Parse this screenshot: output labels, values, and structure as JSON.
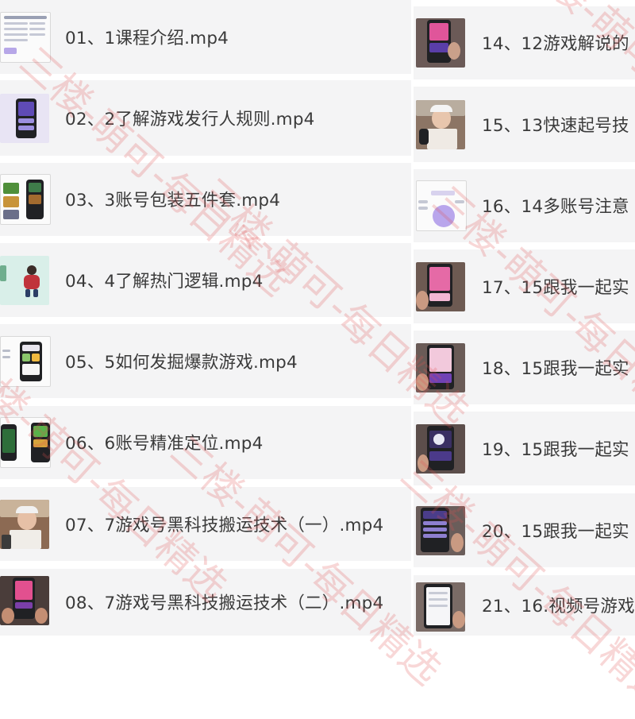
{
  "left_items": [
    {
      "label": "01、1课程介绍.mp4",
      "thumb": "slide-list"
    },
    {
      "label": "02、2了解游戏发行人规则.mp4",
      "thumb": "phone-app"
    },
    {
      "label": "03、3账号包装五件套.mp4",
      "thumb": "game-covers"
    },
    {
      "label": "04、4了解热门逻辑.mp4",
      "thumb": "illustration"
    },
    {
      "label": "05、5如何发掘爆款游戏.mp4",
      "thumb": "phone-app"
    },
    {
      "label": "06、6账号精准定位.mp4",
      "thumb": "phones-pair"
    },
    {
      "label": "07、7游戏号黑科技搬运技术（一）.mp4",
      "thumb": "presenter"
    },
    {
      "label": "08、7游戏号黑科技搬运技术（二）.mp4",
      "thumb": "phone-in-hand"
    }
  ],
  "right_items": [
    {
      "label": "14、12游戏解说的",
      "thumb": "phone-in-hand"
    },
    {
      "label": "15、13快速起号技",
      "thumb": "presenter"
    },
    {
      "label": "16、14多账号注意",
      "thumb": "diagram"
    },
    {
      "label": "17、15跟我一起实",
      "thumb": "phone-in-hand"
    },
    {
      "label": "18、15跟我一起实",
      "thumb": "phone-in-hand"
    },
    {
      "label": "19、15跟我一起实",
      "thumb": "phone-in-hand"
    },
    {
      "label": "20、15跟我一起实",
      "thumb": "phone-in-hand"
    },
    {
      "label": "21、16.视频号游戏",
      "thumb": "phone-in-hand"
    }
  ],
  "watermark_text": "三楼-萌可-每日精选",
  "colors": {
    "row_bg": "#f4f4f5",
    "text": "#3a3a3a",
    "watermark": "#e15050"
  }
}
